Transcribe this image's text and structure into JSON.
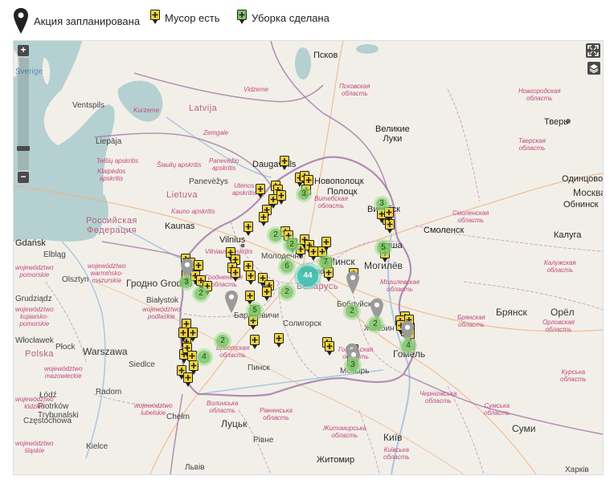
{
  "legend": [
    {
      "label": "Акция запланирована",
      "icon": "planned-pin-icon"
    },
    {
      "label": "Мусор есть",
      "icon": "trash-marker-icon"
    },
    {
      "label": "Уборка сделана",
      "icon": "cleaned-marker-icon"
    }
  ],
  "zoom": {
    "in": "+",
    "out": "−"
  },
  "places": {
    "sverige": "Sverige",
    "pskov": "Псков",
    "pskov_obl": "Псковская область",
    "novgorod_obl": "Новгородская область",
    "tver": "Тверь",
    "tver_obl": "Тверская область",
    "latvija": "Latvija",
    "ventspils": "Ventspils",
    "vidzeme": "Vidzeme",
    "kurzeme": "Kurzeme",
    "zemgale": "Zemgale",
    "liepaja": "Liepāja",
    "siauliu": "Šiaulių apskritis",
    "panevezio": "Panevėžio apskritis",
    "utenos": "Utenos apskritis",
    "daugavpils": "Daugavpils",
    "klaipedos": "Klaipėdos apskritis",
    "telsiu": "Telšių apskritis",
    "panevezys": "Panevėžys",
    "lietuva": "Lietuva",
    "kauno": "Kauno apskritis",
    "kaunas": "Kaunas",
    "vilnius": "Vilnius",
    "vilniaus": "Vilniaus apskritis",
    "novopolotsk": "Новополоцк",
    "polotsk": "Полоцк",
    "vitebsk_obl": "Витебская область",
    "vitebsk": "Витебск",
    "velikie_luki": "Великие Луки",
    "smolensk": "Смоленск",
    "smolensk_obl": "Смоленская область",
    "odintsovo": "Одинцово",
    "moskva": "Москва",
    "obninsk": "Обнинск",
    "kaluga": "Калуга",
    "kaluga_obl": "Калужская область",
    "orsha": "Орша",
    "mogilev": "Могилёв",
    "mogilev_obl": "Могилевская область",
    "ros_fed": "Российская Федерация",
    "gdansk": "Gdańsk",
    "elblag": "Elbląg",
    "olsztyn": "Olsztyn",
    "warminsko": "województwo warmińsko-mazurskie",
    "pomorskie": "województwo pomorskie",
    "grodno": "Гродно Grodno",
    "grodno_obl": "Гродненская область",
    "molodechno": "Молодечно",
    "minsk": "Минск",
    "belarus": "Беларусь",
    "borisov": "Борисов",
    "bobruisk": "Бобруйск",
    "baranovichi": "Барановичи",
    "soligorsk": "Солигорск",
    "bryansk": "Брянск",
    "bryansk_obl": "Брянская область",
    "orel": "Орёл",
    "orel_obl": "Орловская область",
    "grudziadz": "Grudziądz",
    "kujawsko": "województwo kujawsko-pomorskie",
    "bialystok": "Białystok",
    "podlaskie": "województwo podlaskie",
    "plock": "Płock",
    "wloclawek": "Włocławek",
    "warszawa": "Warszawa",
    "polska": "Polska",
    "mazowieckie": "województwo mazowieckie",
    "siedlce": "Siedlce",
    "brest_obl": "Брестская область",
    "pinsk": "Пинск",
    "gomel_obl": "Гомельская область",
    "zhlobin": "Жлобин",
    "mozyr": "Мозырь",
    "gomel": "Гомель",
    "kursk_obl": "Курская область",
    "lodz": "Łódź",
    "piotrkow": "Piotrków Trybunalski",
    "radom": "Radom",
    "lubelskie": "województwo lubelskie",
    "chelm": "Chełm",
    "lodzkie": "województwo łódzkie",
    "czestochowa": "Częstochowa",
    "lutsk": "Луцьк",
    "volyn": "Волинська область",
    "rivne_obl": "Рівненська область",
    "rivne": "Рівне",
    "zhytomyr_obl": "Житомирська область",
    "zhytomyr": "Житомир",
    "kyiv": "Київ",
    "kyiv_obl": "Київська область",
    "chernihiv_obl": "Чернігівська область",
    "sumy": "Суми",
    "sumy_obl": "Сумська область",
    "kharkiv": "Харків",
    "slaskie": "województwo śląskie",
    "lviv": "Львів",
    "kielce": "Kielce"
  },
  "clusters": [
    {
      "count": "2"
    },
    {
      "count": "2"
    },
    {
      "count": "3"
    },
    {
      "count": "6"
    },
    {
      "count": "7"
    },
    {
      "count": "44"
    },
    {
      "count": "2"
    },
    {
      "count": "2"
    },
    {
      "count": "5"
    },
    {
      "count": "3"
    },
    {
      "count": "2"
    },
    {
      "count": "4"
    },
    {
      "count": "5"
    },
    {
      "count": "2"
    },
    {
      "count": "2"
    },
    {
      "count": "3"
    },
    {
      "count": "4"
    },
    {
      "count": "3"
    }
  ],
  "colors": {
    "trash_marker": "#f2d23b",
    "planned_pin": "#222222",
    "planned_pin_map": "#9a9a9a",
    "cleaned_marker": "#7fc46b",
    "cluster_green": "#82c86e",
    "cluster_teal": "#3cbeaf",
    "sea": "#b5d0d0",
    "land": "#f2efe9",
    "border": "#a57ca8"
  }
}
